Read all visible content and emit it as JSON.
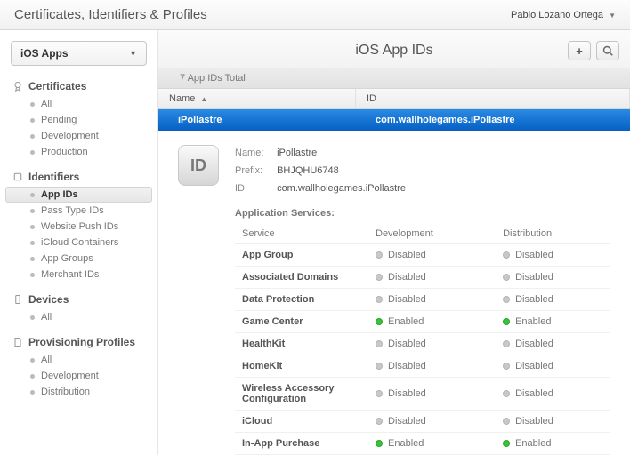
{
  "header": {
    "title": "Certificates, Identifiers & Profiles",
    "user": "Pablo Lozano Ortega"
  },
  "sidebar": {
    "platform_label": "iOS Apps",
    "sections": [
      {
        "title": "Certificates",
        "icon": "cert",
        "items": [
          "All",
          "Pending",
          "Development",
          "Production"
        ]
      },
      {
        "title": "Identifiers",
        "icon": "id",
        "items": [
          "App IDs",
          "Pass Type IDs",
          "Website Push IDs",
          "iCloud Containers",
          "App Groups",
          "Merchant IDs"
        ],
        "active_index": 0
      },
      {
        "title": "Devices",
        "icon": "device",
        "items": [
          "All"
        ]
      },
      {
        "title": "Provisioning Profiles",
        "icon": "profile",
        "items": [
          "All",
          "Development",
          "Distribution"
        ]
      }
    ]
  },
  "content": {
    "page_title": "iOS App IDs",
    "count_text": "7 App IDs Total",
    "columns": {
      "name": "Name",
      "id": "ID"
    },
    "selected_row": {
      "name": "iPollastre",
      "id": "com.wallholegames.iPollastre"
    },
    "detail": {
      "name_label": "Name:",
      "name_value": "iPollastre",
      "prefix_label": "Prefix:",
      "prefix_value": "BHJQHU6748",
      "id_label": "ID:",
      "id_value": "com.wallholegames.iPollastre",
      "services_title": "Application Services:",
      "table_headers": {
        "service": "Service",
        "development": "Development",
        "distribution": "Distribution"
      },
      "services": [
        {
          "name": "App Group",
          "dev": "Disabled",
          "dist": "Disabled"
        },
        {
          "name": "Associated Domains",
          "dev": "Disabled",
          "dist": "Disabled"
        },
        {
          "name": "Data Protection",
          "dev": "Disabled",
          "dist": "Disabled"
        },
        {
          "name": "Game Center",
          "dev": "Enabled",
          "dist": "Enabled"
        },
        {
          "name": "HealthKit",
          "dev": "Disabled",
          "dist": "Disabled"
        },
        {
          "name": "HomeKit",
          "dev": "Disabled",
          "dist": "Disabled"
        },
        {
          "name": "Wireless Accessory Configuration",
          "dev": "Disabled",
          "dist": "Disabled"
        },
        {
          "name": "iCloud",
          "dev": "Disabled",
          "dist": "Disabled"
        },
        {
          "name": "In-App Purchase",
          "dev": "Enabled",
          "dist": "Enabled"
        }
      ]
    }
  }
}
